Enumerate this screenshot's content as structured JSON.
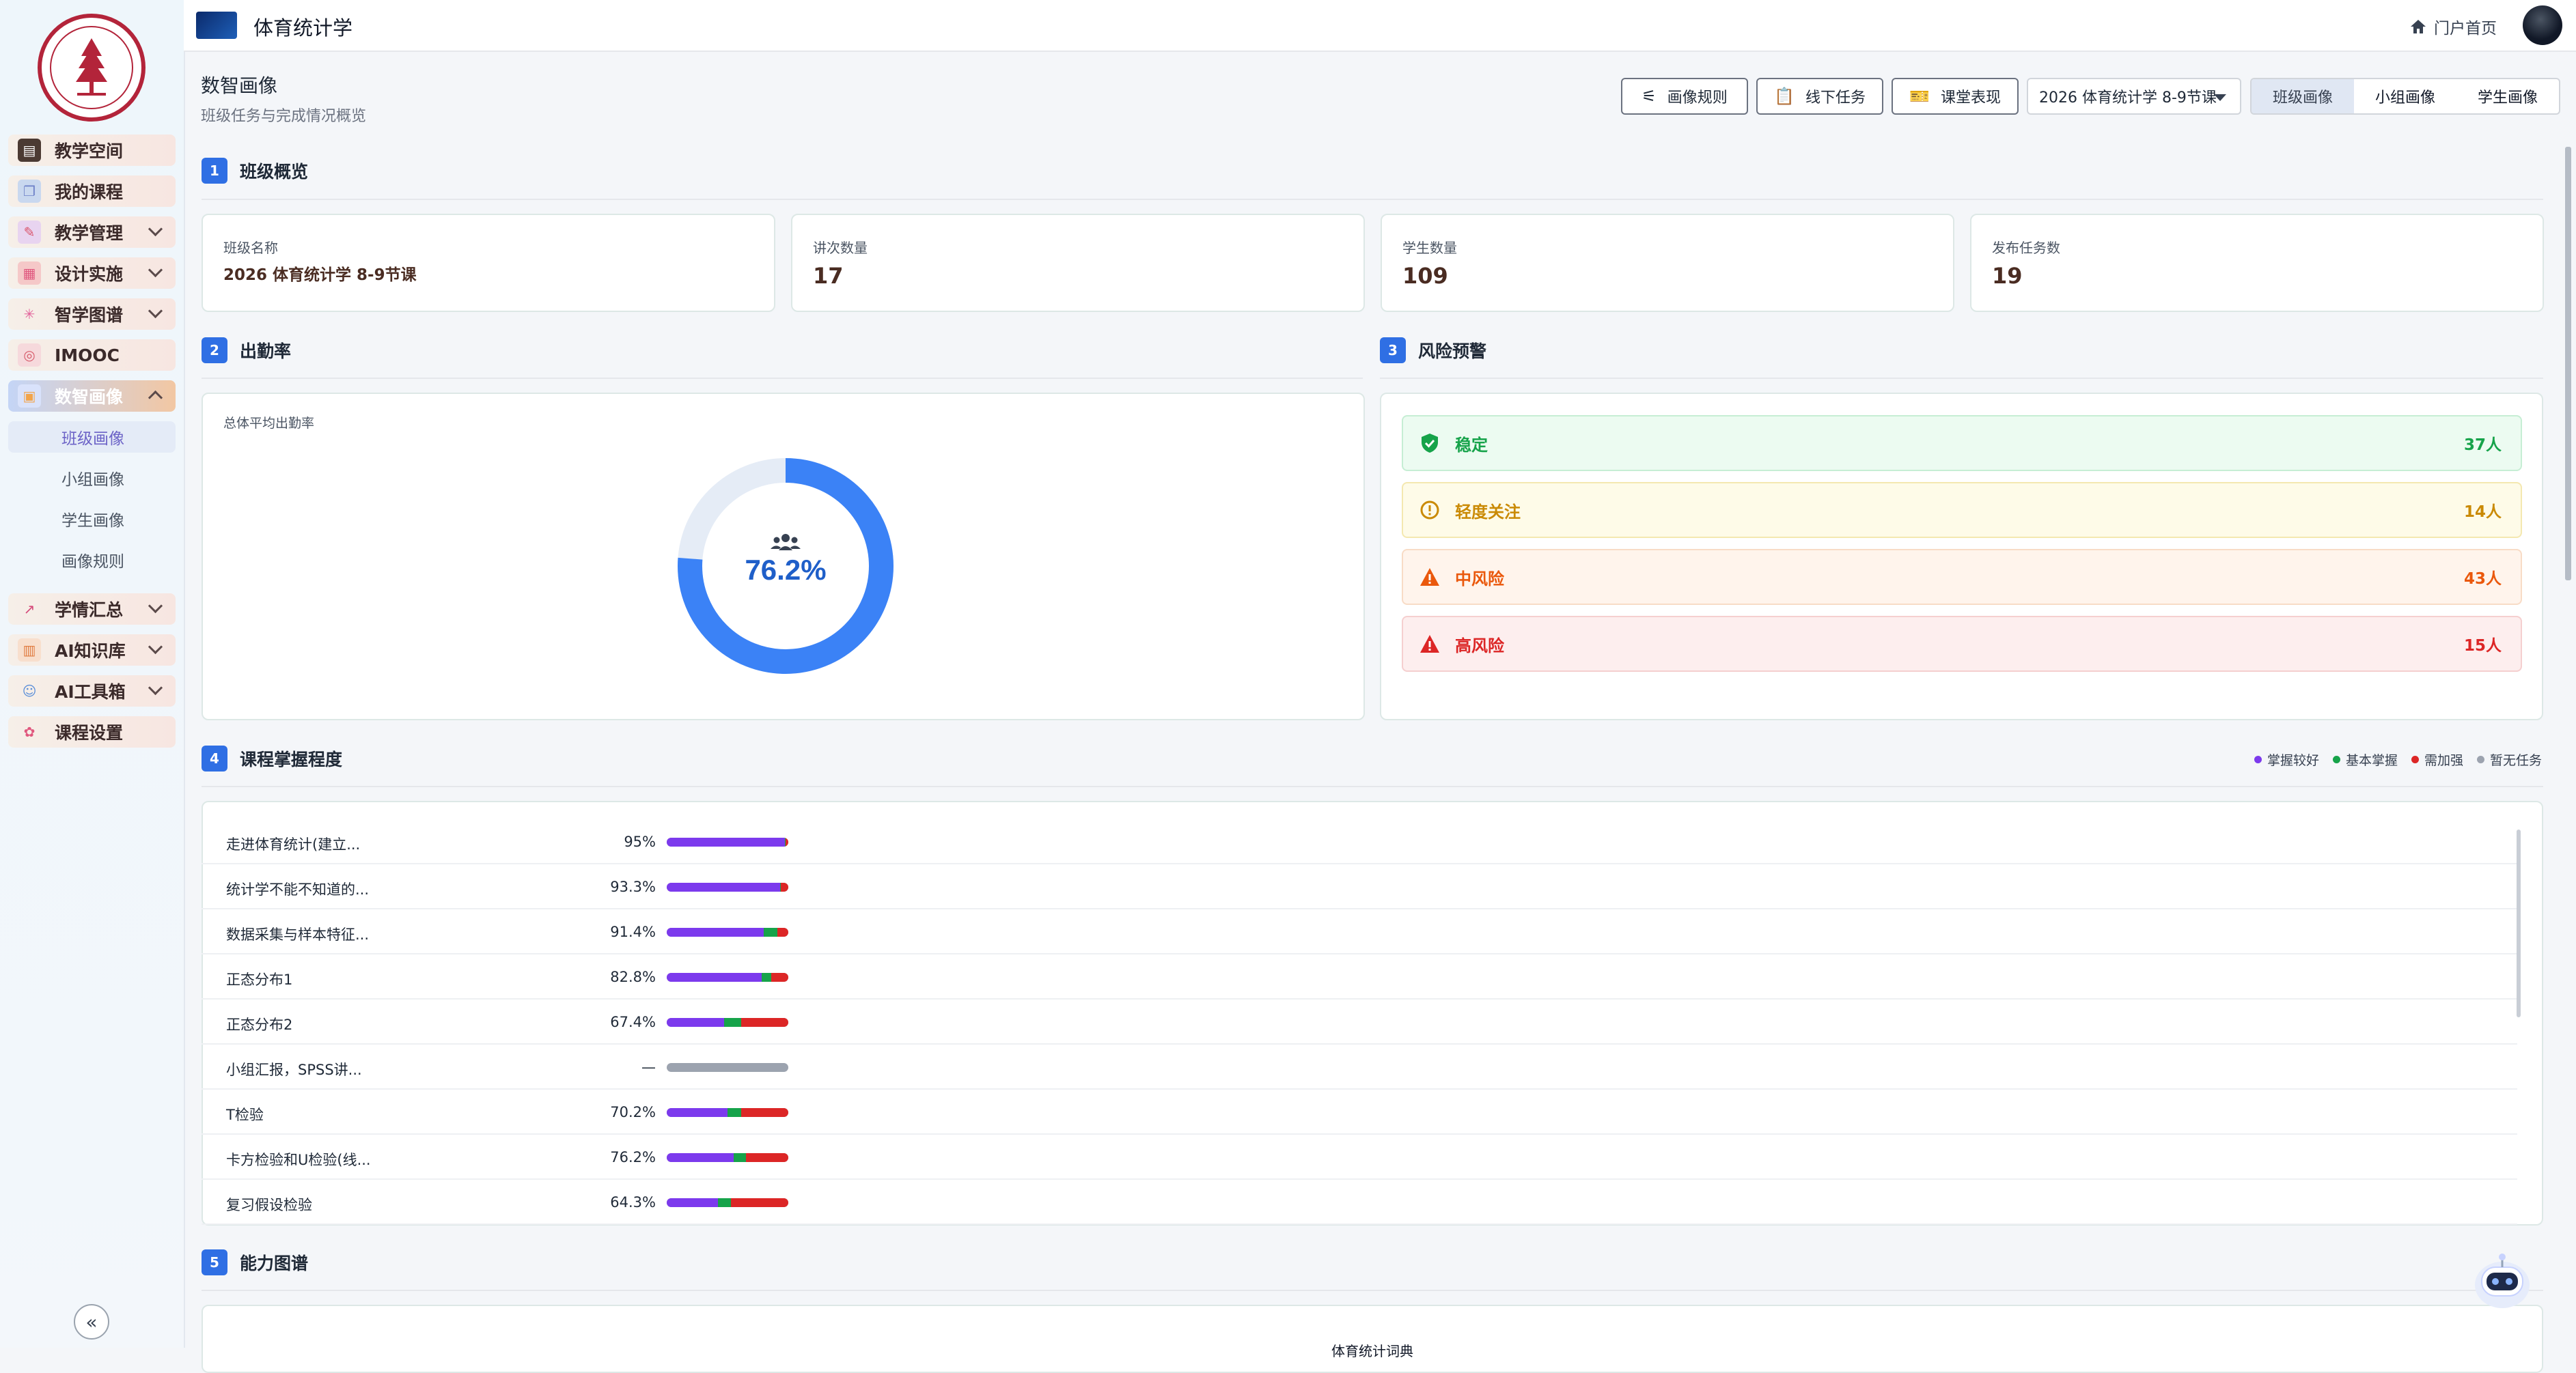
{
  "sidebar": {
    "items": [
      {
        "label": "教学空间",
        "icon": "book-icon",
        "expandable": false
      },
      {
        "label": "我的课程",
        "icon": "open-book-icon",
        "expandable": false
      },
      {
        "label": "教学管理",
        "icon": "pencil-icon",
        "expandable": true
      },
      {
        "label": "设计实施",
        "icon": "layout-icon",
        "expandable": true
      },
      {
        "label": "智学图谱",
        "icon": "sparkle-icon",
        "expandable": true
      },
      {
        "label": "IMOOC",
        "icon": "circle-icon",
        "expandable": false
      },
      {
        "label": "数智画像",
        "icon": "dashboard-icon",
        "expandable": true,
        "active": true
      },
      {
        "label": "学情汇总",
        "icon": "trend-icon",
        "expandable": true
      },
      {
        "label": "AI知识库",
        "icon": "database-icon",
        "expandable": true
      },
      {
        "label": "AI工具箱",
        "icon": "robot-icon",
        "expandable": true
      },
      {
        "label": "课程设置",
        "icon": "settings-icon",
        "expandable": false
      }
    ],
    "sub_items": [
      {
        "label": "班级画像",
        "active": true
      },
      {
        "label": "小组画像"
      },
      {
        "label": "学生画像"
      },
      {
        "label": "画像规则"
      }
    ],
    "collapse_icon": "«"
  },
  "topbar": {
    "course_title": "体育统计学",
    "portal_label": "门户首页"
  },
  "header": {
    "title": "数智画像",
    "subtitle": "班级任务与完成情况概览",
    "buttons": [
      "画像规则",
      "线下任务",
      "课堂表现"
    ],
    "class_select": "2026 体育统计学 8-9节课",
    "tabs": [
      {
        "label": "班级画像",
        "active": true
      },
      {
        "label": "小组画像"
      },
      {
        "label": "学生画像"
      }
    ]
  },
  "sections": {
    "overview": {
      "num": "1",
      "title": "班级概览"
    },
    "attendance": {
      "num": "2",
      "title": "出勤率"
    },
    "risk": {
      "num": "3",
      "title": "风险预警"
    },
    "mastery": {
      "num": "4",
      "title": "课程掌握程度"
    },
    "ability": {
      "num": "5",
      "title": "能力图谱"
    }
  },
  "overview": {
    "class_name_label": "班级名称",
    "class_name": "2026 体育统计学 8-9节课",
    "lectures_label": "讲次数量",
    "lectures": "17",
    "students_label": "学生数量",
    "students": "109",
    "tasks_label": "发布任务数",
    "tasks": "19"
  },
  "attendance": {
    "label": "总体平均出勤率",
    "value_text": "76.2%",
    "value": 0.762,
    "color": "#3b82f6",
    "track_color": "#e5ecf6"
  },
  "risk": [
    {
      "name": "稳定",
      "count": "37人",
      "color": "#16a34a",
      "bg": "#ecfbf1",
      "border": "#c6eed4",
      "icon": "shield-check-icon"
    },
    {
      "name": "轻度关注",
      "count": "14人",
      "color": "#ca8a04",
      "bg": "#fefbe8",
      "border": "#f4e8b0",
      "icon": "info-circle-icon"
    },
    {
      "name": "中风险",
      "count": "43人",
      "color": "#ea580c",
      "bg": "#fff4ec",
      "border": "#f8dcc6",
      "icon": "warning-icon"
    },
    {
      "name": "高风险",
      "count": "15人",
      "color": "#dc2626",
      "bg": "#fdeeee",
      "border": "#f5cfcf",
      "icon": "warning-icon"
    }
  ],
  "mastery_legend": [
    {
      "label": "掌握较好",
      "color": "#7c3aed"
    },
    {
      "label": "基本掌握",
      "color": "#16a34a"
    },
    {
      "label": "需加强",
      "color": "#dc2626"
    },
    {
      "label": "暂无任务",
      "color": "#9ca3af"
    }
  ],
  "mastery_rows": [
    {
      "name": "走进体育统计(建立...",
      "pct": "95%",
      "good": 0.97,
      "basic": 0.01,
      "weak": 0.02
    },
    {
      "name": "统计学不能不知道的...",
      "pct": "93.3%",
      "good": 0.93,
      "basic": 0.01,
      "weak": 0.06
    },
    {
      "name": "数据采集与样本特征...",
      "pct": "91.4%",
      "good": 0.8,
      "basic": 0.11,
      "weak": 0.09
    },
    {
      "name": "正态分布1",
      "pct": "82.8%",
      "good": 0.78,
      "basic": 0.08,
      "weak": 0.14
    },
    {
      "name": "正态分布2",
      "pct": "67.4%",
      "good": 0.47,
      "basic": 0.14,
      "weak": 0.39
    },
    {
      "name": "小组汇报，SPSS讲...",
      "pct": "—",
      "good": 0,
      "basic": 0,
      "weak": 0
    },
    {
      "name": "T检验",
      "pct": "70.2%",
      "good": 0.5,
      "basic": 0.11,
      "weak": 0.39
    },
    {
      "name": "卡方检验和U检验(线...",
      "pct": "76.2%",
      "good": 0.55,
      "basic": 0.1,
      "weak": 0.35
    },
    {
      "name": "复习假设检验",
      "pct": "64.3%",
      "good": 0.42,
      "basic": 0.11,
      "weak": 0.47
    }
  ],
  "ability": {
    "chart_title_partial": "体育统计词典"
  }
}
